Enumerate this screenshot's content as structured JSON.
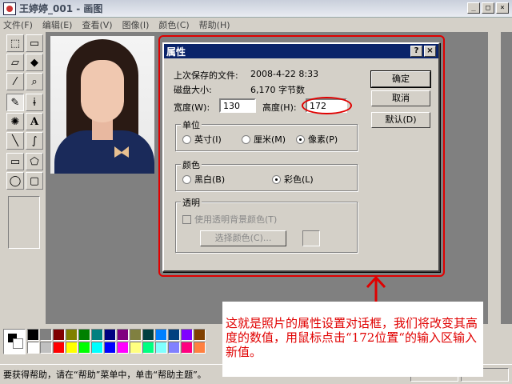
{
  "window": {
    "title": "王婷婷_001 - 画图",
    "controls": [
      "_",
      "□",
      "×"
    ]
  },
  "menu": [
    "文件(F)",
    "编辑(E)",
    "查看(V)",
    "图像(I)",
    "颜色(C)",
    "帮助(H)"
  ],
  "toolbox": {
    "tools": [
      {
        "name": "free-select-icon",
        "glyph": "⬚"
      },
      {
        "name": "rect-select-icon",
        "glyph": "▭"
      },
      {
        "name": "eraser-icon",
        "glyph": "▱"
      },
      {
        "name": "fill-icon",
        "glyph": "◆"
      },
      {
        "name": "color-picker-icon",
        "glyph": "⁄"
      },
      {
        "name": "magnifier-icon",
        "glyph": "⌕"
      },
      {
        "name": "pencil-icon",
        "glyph": "✎"
      },
      {
        "name": "brush-icon",
        "glyph": "ɨ"
      },
      {
        "name": "airbrush-icon",
        "glyph": "✺"
      },
      {
        "name": "text-icon",
        "glyph": "A"
      },
      {
        "name": "line-icon",
        "glyph": "╲"
      },
      {
        "name": "curve-icon",
        "glyph": "∫"
      },
      {
        "name": "rectangle-icon",
        "glyph": "▭"
      },
      {
        "name": "polygon-icon",
        "glyph": "⬠"
      },
      {
        "name": "ellipse-icon",
        "glyph": "◯"
      },
      {
        "name": "rounded-rect-icon",
        "glyph": "▢"
      }
    ]
  },
  "palette": {
    "top": [
      "#000000",
      "#808080",
      "#800000",
      "#808000",
      "#008000",
      "#008080",
      "#000080",
      "#800080",
      "#808040",
      "#004040",
      "#0080ff",
      "#004080",
      "#8000ff",
      "#804000"
    ],
    "bottom": [
      "#ffffff",
      "#c0c0c0",
      "#ff0000",
      "#ffff00",
      "#00ff00",
      "#00ffff",
      "#0000ff",
      "#ff00ff",
      "#ffff80",
      "#00ff80",
      "#80ffff",
      "#8080ff",
      "#ff0080",
      "#ff8040"
    ]
  },
  "status": {
    "text": "要获得帮助，请在“帮助”菜单中，单击“帮助主题”。"
  },
  "dialog": {
    "title": "属性",
    "help_btn": "?",
    "close_btn": "×",
    "last_saved_label": "上次保存的文件:",
    "last_saved_value": "2008-4-22 8:33",
    "disk_size_label": "磁盘大小:",
    "disk_size_value": "6,170 字节数",
    "width_label": "宽度(W):",
    "width_value": "130",
    "height_label": "高度(H):",
    "height_value": "172",
    "ok": "确定",
    "cancel": "取消",
    "default": "默认(D)",
    "units": {
      "title": "单位",
      "inches": "英寸(I)",
      "cm": "厘米(M)",
      "pixels": "像素(P)"
    },
    "colors": {
      "title": "颜色",
      "bw": "黑白(B)",
      "color": "彩色(L)"
    },
    "transparency": {
      "title": "透明",
      "use_bg": "使用透明背景颜色(T)",
      "select_color": "选择颜色(C)..."
    }
  },
  "annotation": {
    "note": "这就是照片的属性设置对话框，我们将改变其高度的数值，用鼠标点击“172位置“的输入区输入新值。"
  }
}
